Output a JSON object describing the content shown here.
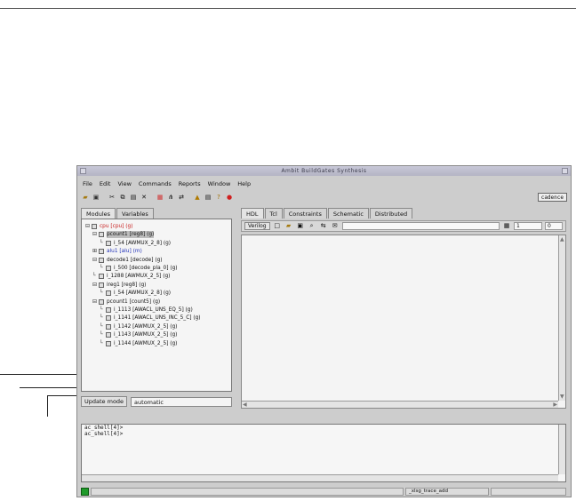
{
  "window": {
    "title": "Ambit BuildGates Synthesis"
  },
  "menu": [
    "File",
    "Edit",
    "View",
    "Commands",
    "Reports",
    "Window",
    "Help"
  ],
  "toolbar": {
    "icons": [
      "open-icon",
      "save-icon",
      "cut-icon",
      "copy-icon",
      "paste-icon",
      "delete-icon",
      "schematic-icon",
      "hierarchy-icon",
      "net-icon",
      "warning-icon",
      "report-icon",
      "help-icon",
      "stop-icon"
    ],
    "brand": "cadence"
  },
  "left_tabs": [
    "Modules",
    "Variables"
  ],
  "tree": [
    {
      "text": "cpu [cpu] (g)",
      "level": 0,
      "color": "red",
      "twisty": "⊟"
    },
    {
      "text": "pcount1 [reg8] (g)",
      "level": 1,
      "color": "normal",
      "twisty": "⊟",
      "selected": true
    },
    {
      "text": "i_54 [AWMUX_2_8] (g)",
      "level": 2,
      "color": "normal",
      "twisty": ""
    },
    {
      "text": "alu1 [alu] (m)",
      "level": 1,
      "color": "blue",
      "twisty": "⊞"
    },
    {
      "text": "decode1 [decode] (g)",
      "level": 1,
      "color": "normal",
      "twisty": "⊟"
    },
    {
      "text": "i_500 [decode_pla_0] (g)",
      "level": 2,
      "color": "normal",
      "twisty": ""
    },
    {
      "text": "i_1288 [AWMUX_2_5] (g)",
      "level": 1,
      "color": "normal",
      "twisty": ""
    },
    {
      "text": "ireg1 [reg8] (g)",
      "level": 1,
      "color": "normal",
      "twisty": "⊟"
    },
    {
      "text": "i_54 [AWMUX_2_8] (g)",
      "level": 2,
      "color": "normal",
      "twisty": ""
    },
    {
      "text": "pcount1 [count5] (g)",
      "level": 1,
      "color": "normal",
      "twisty": "⊟"
    },
    {
      "text": "i_1113 [AWACL_UNS_EQ_5] (g)",
      "level": 2,
      "color": "normal",
      "twisty": ""
    },
    {
      "text": "i_1141 [AWACL_UNS_INC_5_C] (g)",
      "level": 2,
      "color": "normal",
      "twisty": ""
    },
    {
      "text": "i_1142 [AWMUX_2_5] (g)",
      "level": 2,
      "color": "normal",
      "twisty": ""
    },
    {
      "text": "i_1143 [AWMUX_2_5] (g)",
      "level": 2,
      "color": "normal",
      "twisty": ""
    },
    {
      "text": "i_1144 [AWMUX_2_5] (g)",
      "level": 2,
      "color": "normal",
      "twisty": ""
    }
  ],
  "update_mode": {
    "label": "Update mode",
    "value": "automatic"
  },
  "right_tabs": [
    "HDL",
    "Tcl",
    "Constraints",
    "Schematic",
    "Distributed"
  ],
  "editor_toolbar": {
    "language": "Verilog",
    "spin_a": "1",
    "spin_b": "0"
  },
  "console_lines": [
    "ac_shell[4]>",
    "ac_shell[4]>"
  ],
  "status": {
    "message": "_xlsg_trace_add"
  }
}
